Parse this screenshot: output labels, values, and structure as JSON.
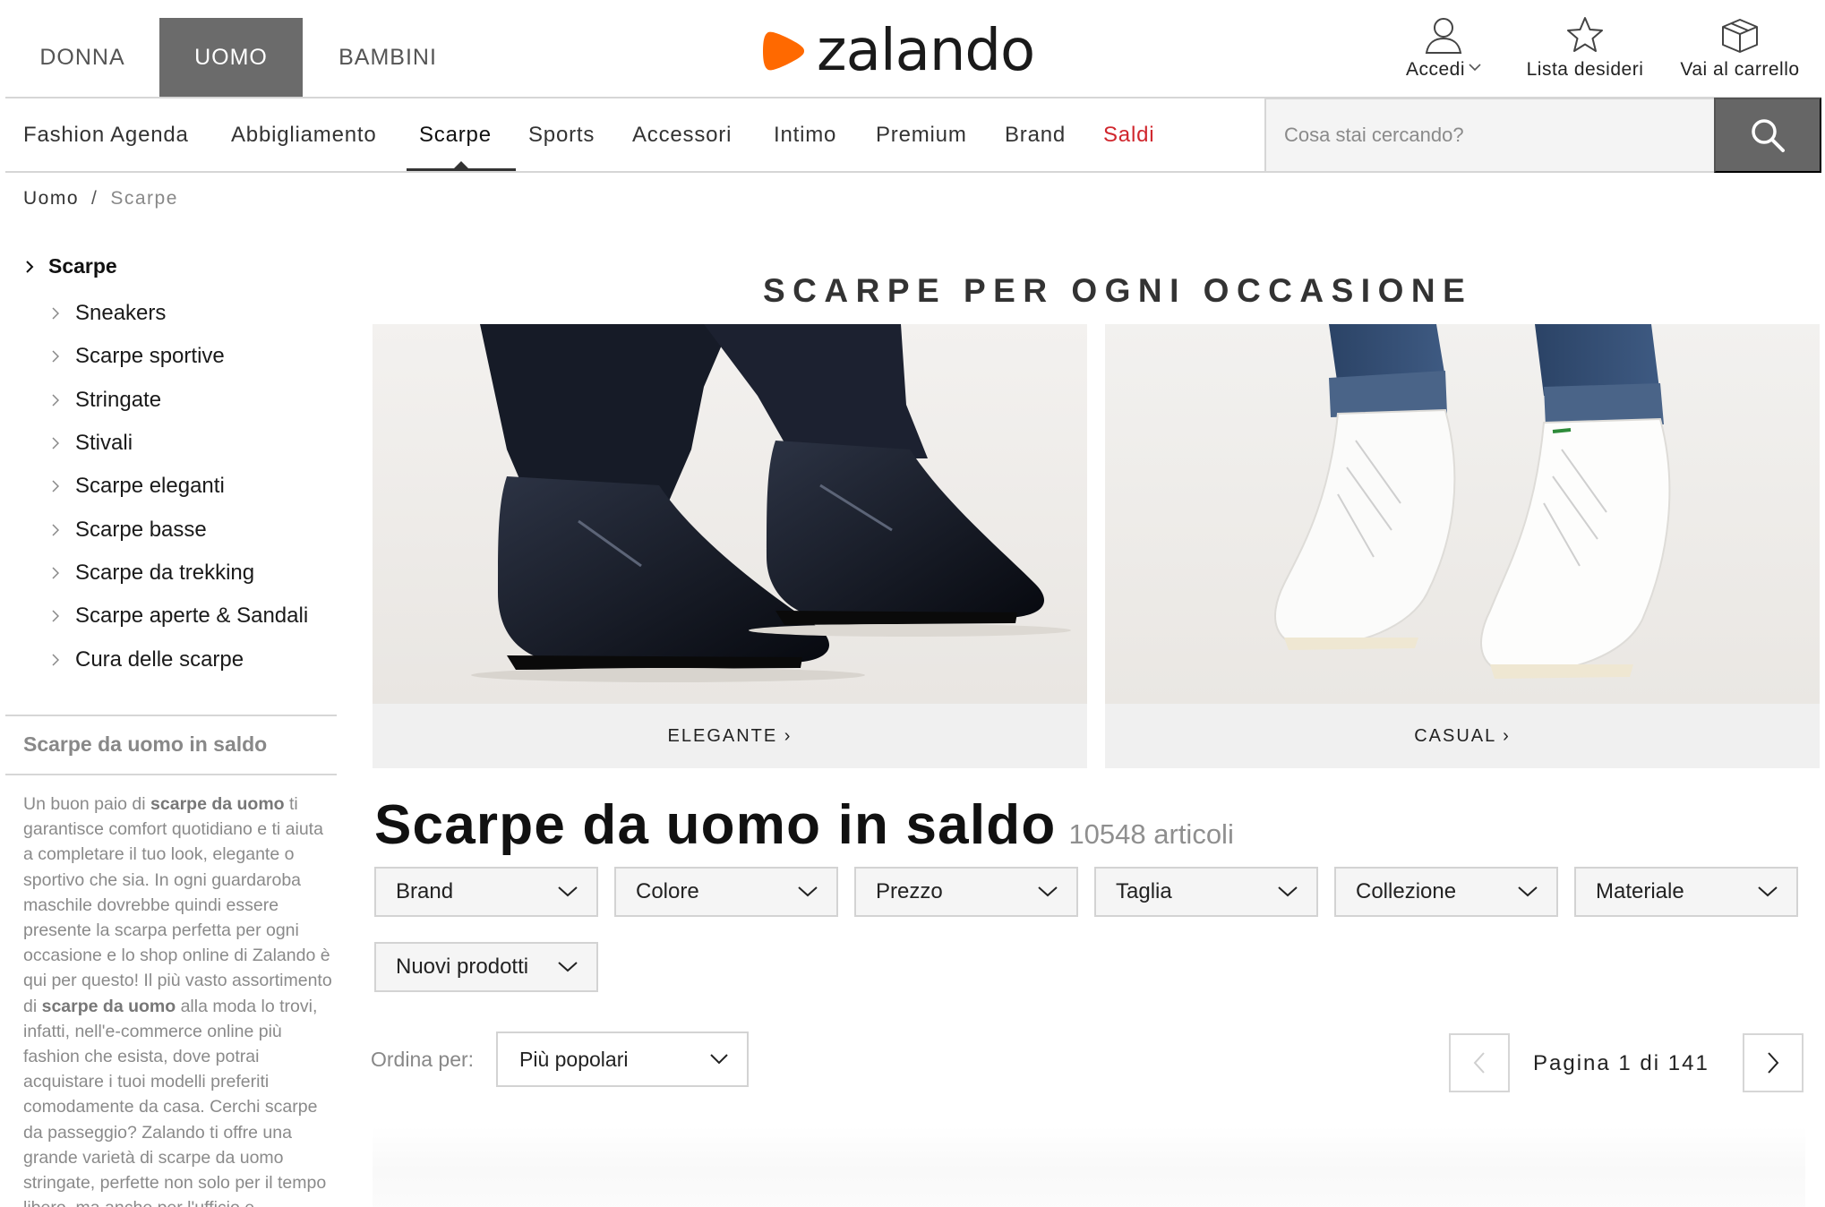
{
  "gender_tabs": [
    {
      "label": "DONNA",
      "active": false
    },
    {
      "label": "UOMO",
      "active": true
    },
    {
      "label": "BAMBINI",
      "active": false
    }
  ],
  "logo": {
    "text": "zalando",
    "color": "#ff6900"
  },
  "tools": {
    "accedi": {
      "label": "Accedi",
      "icon": "user-icon"
    },
    "lista": {
      "label": "Lista desideri",
      "icon": "star-icon"
    },
    "carrello": {
      "label": "Vai al carrello",
      "icon": "box-icon"
    }
  },
  "categories": [
    {
      "label": "Fashion Agenda"
    },
    {
      "label": "Abbigliamento"
    },
    {
      "label": "Scarpe",
      "active": true
    },
    {
      "label": "Sports"
    },
    {
      "label": "Accessori"
    },
    {
      "label": "Intimo"
    },
    {
      "label": "Premium"
    },
    {
      "label": "Brand"
    },
    {
      "label": "Saldi",
      "color": "#d0262d"
    }
  ],
  "search": {
    "placeholder": "Cosa stai cercando?"
  },
  "breadcrumb": {
    "root": "Uomo",
    "separator": "/",
    "current": "Scarpe"
  },
  "sidebar": {
    "heading": "Scarpe",
    "items": [
      {
        "label": "Sneakers"
      },
      {
        "label": "Scarpe sportive"
      },
      {
        "label": "Stringate"
      },
      {
        "label": "Stivali"
      },
      {
        "label": "Scarpe eleganti"
      },
      {
        "label": "Scarpe basse"
      },
      {
        "label": "Scarpe da trekking"
      },
      {
        "label": "Scarpe aperte & Sandali"
      },
      {
        "label": "Cura delle scarpe"
      }
    ],
    "seo_title": "Scarpe da uomo in saldo",
    "seo_parts": [
      {
        "t": "Un buon paio di ",
        "b": false
      },
      {
        "t": "scarpe da uomo",
        "b": true
      },
      {
        "t": " ti garantisce comfort quotidiano e ti aiuta a completare il tuo look, elegante o sportivo che sia. In ogni guardaroba maschile dovrebbe quindi essere presente la scarpa perfetta per ogni occasione e lo shop online di Zalando è qui per questo! Il più vasto assortimento di ",
        "b": false
      },
      {
        "t": "scarpe da uomo",
        "b": true
      },
      {
        "t": " alla moda lo trovi, infatti, nell'e-commerce online più fashion che esista, dove potrai acquistare i tuoi modelli preferiti comodamente da casa. Cerchi scarpe da passeggio? Zalando ti offre una grande varietà di scarpe da uomo stringate, perfette non solo per il tempo libero, ma anche per l'ufficio e",
        "b": false
      }
    ]
  },
  "hero": {
    "title": "SCARPE PER OGNI OCCASIONE",
    "tiles": [
      {
        "label": "ELEGANTE ›"
      },
      {
        "label": "CASUAL ›"
      }
    ]
  },
  "results": {
    "title": "Scarpe da uomo in saldo",
    "count": "10548 articoli"
  },
  "filters": [
    {
      "label": "Brand"
    },
    {
      "label": "Colore"
    },
    {
      "label": "Prezzo"
    },
    {
      "label": "Taglia"
    },
    {
      "label": "Collezione"
    },
    {
      "label": "Materiale"
    },
    {
      "label": "Nuovi prodotti"
    }
  ],
  "sort": {
    "label": "Ordina per:",
    "selected": "Più popolari"
  },
  "pagination": {
    "text": "Pagina 1 di 141"
  }
}
